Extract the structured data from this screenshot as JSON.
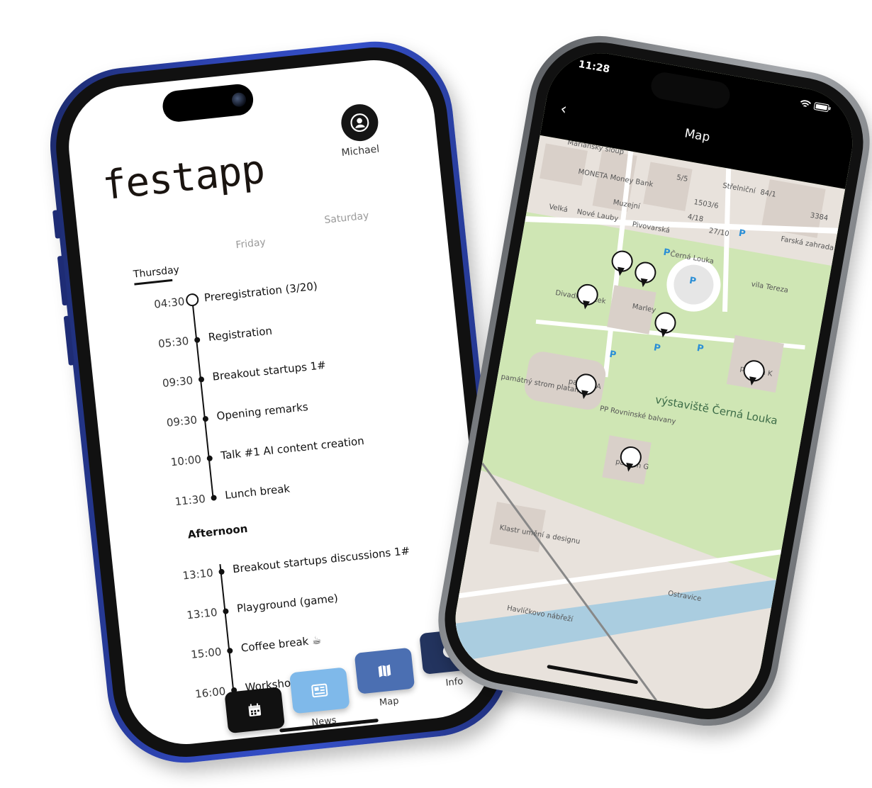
{
  "schedule_app": {
    "logo": "festapp",
    "user": {
      "name": "Michael"
    },
    "days": [
      "Thursday",
      "Friday",
      "Saturday"
    ],
    "events": [
      {
        "time": "04:30",
        "title": "Preregistration (3/20)"
      },
      {
        "time": "05:30",
        "title": "Registration"
      },
      {
        "time": "09:30",
        "title": "Breakout startups 1#"
      },
      {
        "time": "09:30",
        "title": "Opening remarks"
      },
      {
        "time": "10:00",
        "title": "Talk #1 AI content creation"
      },
      {
        "time": "11:30",
        "title": "Lunch break"
      }
    ],
    "afternoon_title": "Afternoon",
    "afternoon_events": [
      {
        "time": "13:10",
        "title": "Breakout startups discussions 1#"
      },
      {
        "time": "13:10",
        "title": "Playground (game)"
      },
      {
        "time": "15:00",
        "title": "Coffee break ☕"
      },
      {
        "time": "16:00",
        "title": "Workshops 🛠"
      }
    ],
    "nav": [
      {
        "label": "My schedule",
        "icon": "calendar-icon",
        "color": "#111111"
      },
      {
        "label": "News",
        "icon": "news-icon",
        "color": "#7fb9ea"
      },
      {
        "label": "Map",
        "icon": "map-icon",
        "color": "#4b6fb2"
      },
      {
        "label": "Info",
        "icon": "info-icon",
        "color": "#23345f"
      }
    ]
  },
  "map_app": {
    "status_time": "11:28",
    "title": "Map",
    "labels": [
      "Mariánský sloup",
      "MONETA Money Bank",
      "Nové Lauby",
      "Velká",
      "Muzejní",
      "Pivovarská",
      "Střelniční",
      "Farská zahrada",
      "vila Tereza",
      "Černá Louka",
      "Divadlo loutek",
      "Marley",
      "pavilon A",
      "pavilon K",
      "pavilon G",
      "výstaviště Černá Louka",
      "PP Rovninské balvany",
      "památný strom platan",
      "Klastr umění a designu",
      "Havlíčkovo nábřeží",
      "Ostravice",
      "84/1",
      "3384",
      "5/5",
      "1503/6",
      "4/18",
      "27/10"
    ]
  }
}
